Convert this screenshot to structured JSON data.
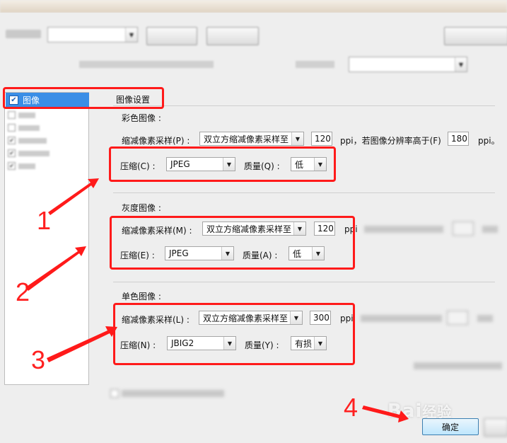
{
  "section_header": "图像设置",
  "sidebar": {
    "selected_item": "图像"
  },
  "color": {
    "heading": "彩色图像 :",
    "downsample_label": "缩减像素采样(P) :",
    "downsample_value": "双立方缩减像素采样至",
    "ppi_value": "120",
    "ppi_text": "ppi，若图像分辨率高于(F)",
    "above_value": "180",
    "ppi_unit": "ppi。",
    "compress_label": "压缩(C) :",
    "compress_value": "JPEG",
    "quality_label": "质量(Q) :",
    "quality_value": "低"
  },
  "gray": {
    "heading": "灰度图像 :",
    "downsample_label": "缩减像素采样(M) :",
    "downsample_value": "双立方缩减像素采样至",
    "ppi_value": "120",
    "ppi_text": "ppi",
    "compress_label": "压缩(E) :",
    "compress_value": "JPEG",
    "quality_label": "质量(A) :",
    "quality_value": "低"
  },
  "mono": {
    "heading": "单色图像 :",
    "downsample_label": "缩减像素采样(L) :",
    "downsample_value": "双立方缩减像素采样至",
    "ppi_value": "300",
    "ppi_text": "ppi",
    "compress_label": "压缩(N) :",
    "compress_value": "JBIG2",
    "quality_label": "质量(Y) :",
    "quality_value": "有损"
  },
  "ok_button": "确定",
  "annotations": [
    "1",
    "2",
    "3",
    "4"
  ],
  "watermark": "Bai经验",
  "colors": {
    "annotation": "#ff1a1a",
    "selection": "#3a8ee6"
  }
}
